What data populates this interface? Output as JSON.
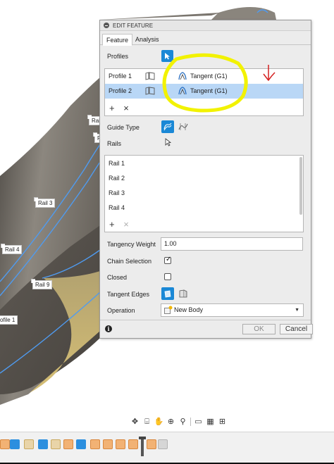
{
  "panel": {
    "title": "EDIT FEATURE",
    "tabs": [
      {
        "label": "Feature"
      },
      {
        "label": "Analysis"
      }
    ],
    "profiles_label": "Profiles",
    "profiles": [
      {
        "name": "Profile 1",
        "condition": "Tangent (G1)"
      },
      {
        "name": "Profile 2",
        "condition": "Tangent (G1)"
      }
    ],
    "add_symbol": "+",
    "remove_symbol": "×",
    "guide_type_label": "Guide Type",
    "rails_label": "Rails",
    "rails": [
      "Rail 1",
      "Rail 2",
      "Rail 3",
      "Rail 4"
    ],
    "tangency_weight_label": "Tangency Weight",
    "tangency_weight_value": "1.00",
    "chain_selection_label": "Chain Selection",
    "chain_selection_checked": true,
    "closed_label": "Closed",
    "closed_checked": false,
    "tangent_edges_label": "Tangent Edges",
    "operation_label": "Operation",
    "operation_value": "New Body",
    "info_symbol": "i",
    "ok_label": "OK",
    "cancel_label": "Cancel"
  },
  "viewport": {
    "rail_labels": [
      "Rail 3",
      "Rail 4",
      "Rail 9",
      "Rail 1"
    ],
    "side_label_1": "Rai",
    "side_label_2": "R",
    "profile_tag": "ofile 1"
  },
  "annotation": {
    "highlight_color": "#f2f200",
    "arrow_color": "#d42020"
  },
  "colors": {
    "accent": "#1a88d6",
    "selected_row": "#b9d7f6",
    "rail_edge": "#4f9bf0",
    "surface_dark": "#6b6660",
    "surface_tan": "#c9b064"
  }
}
